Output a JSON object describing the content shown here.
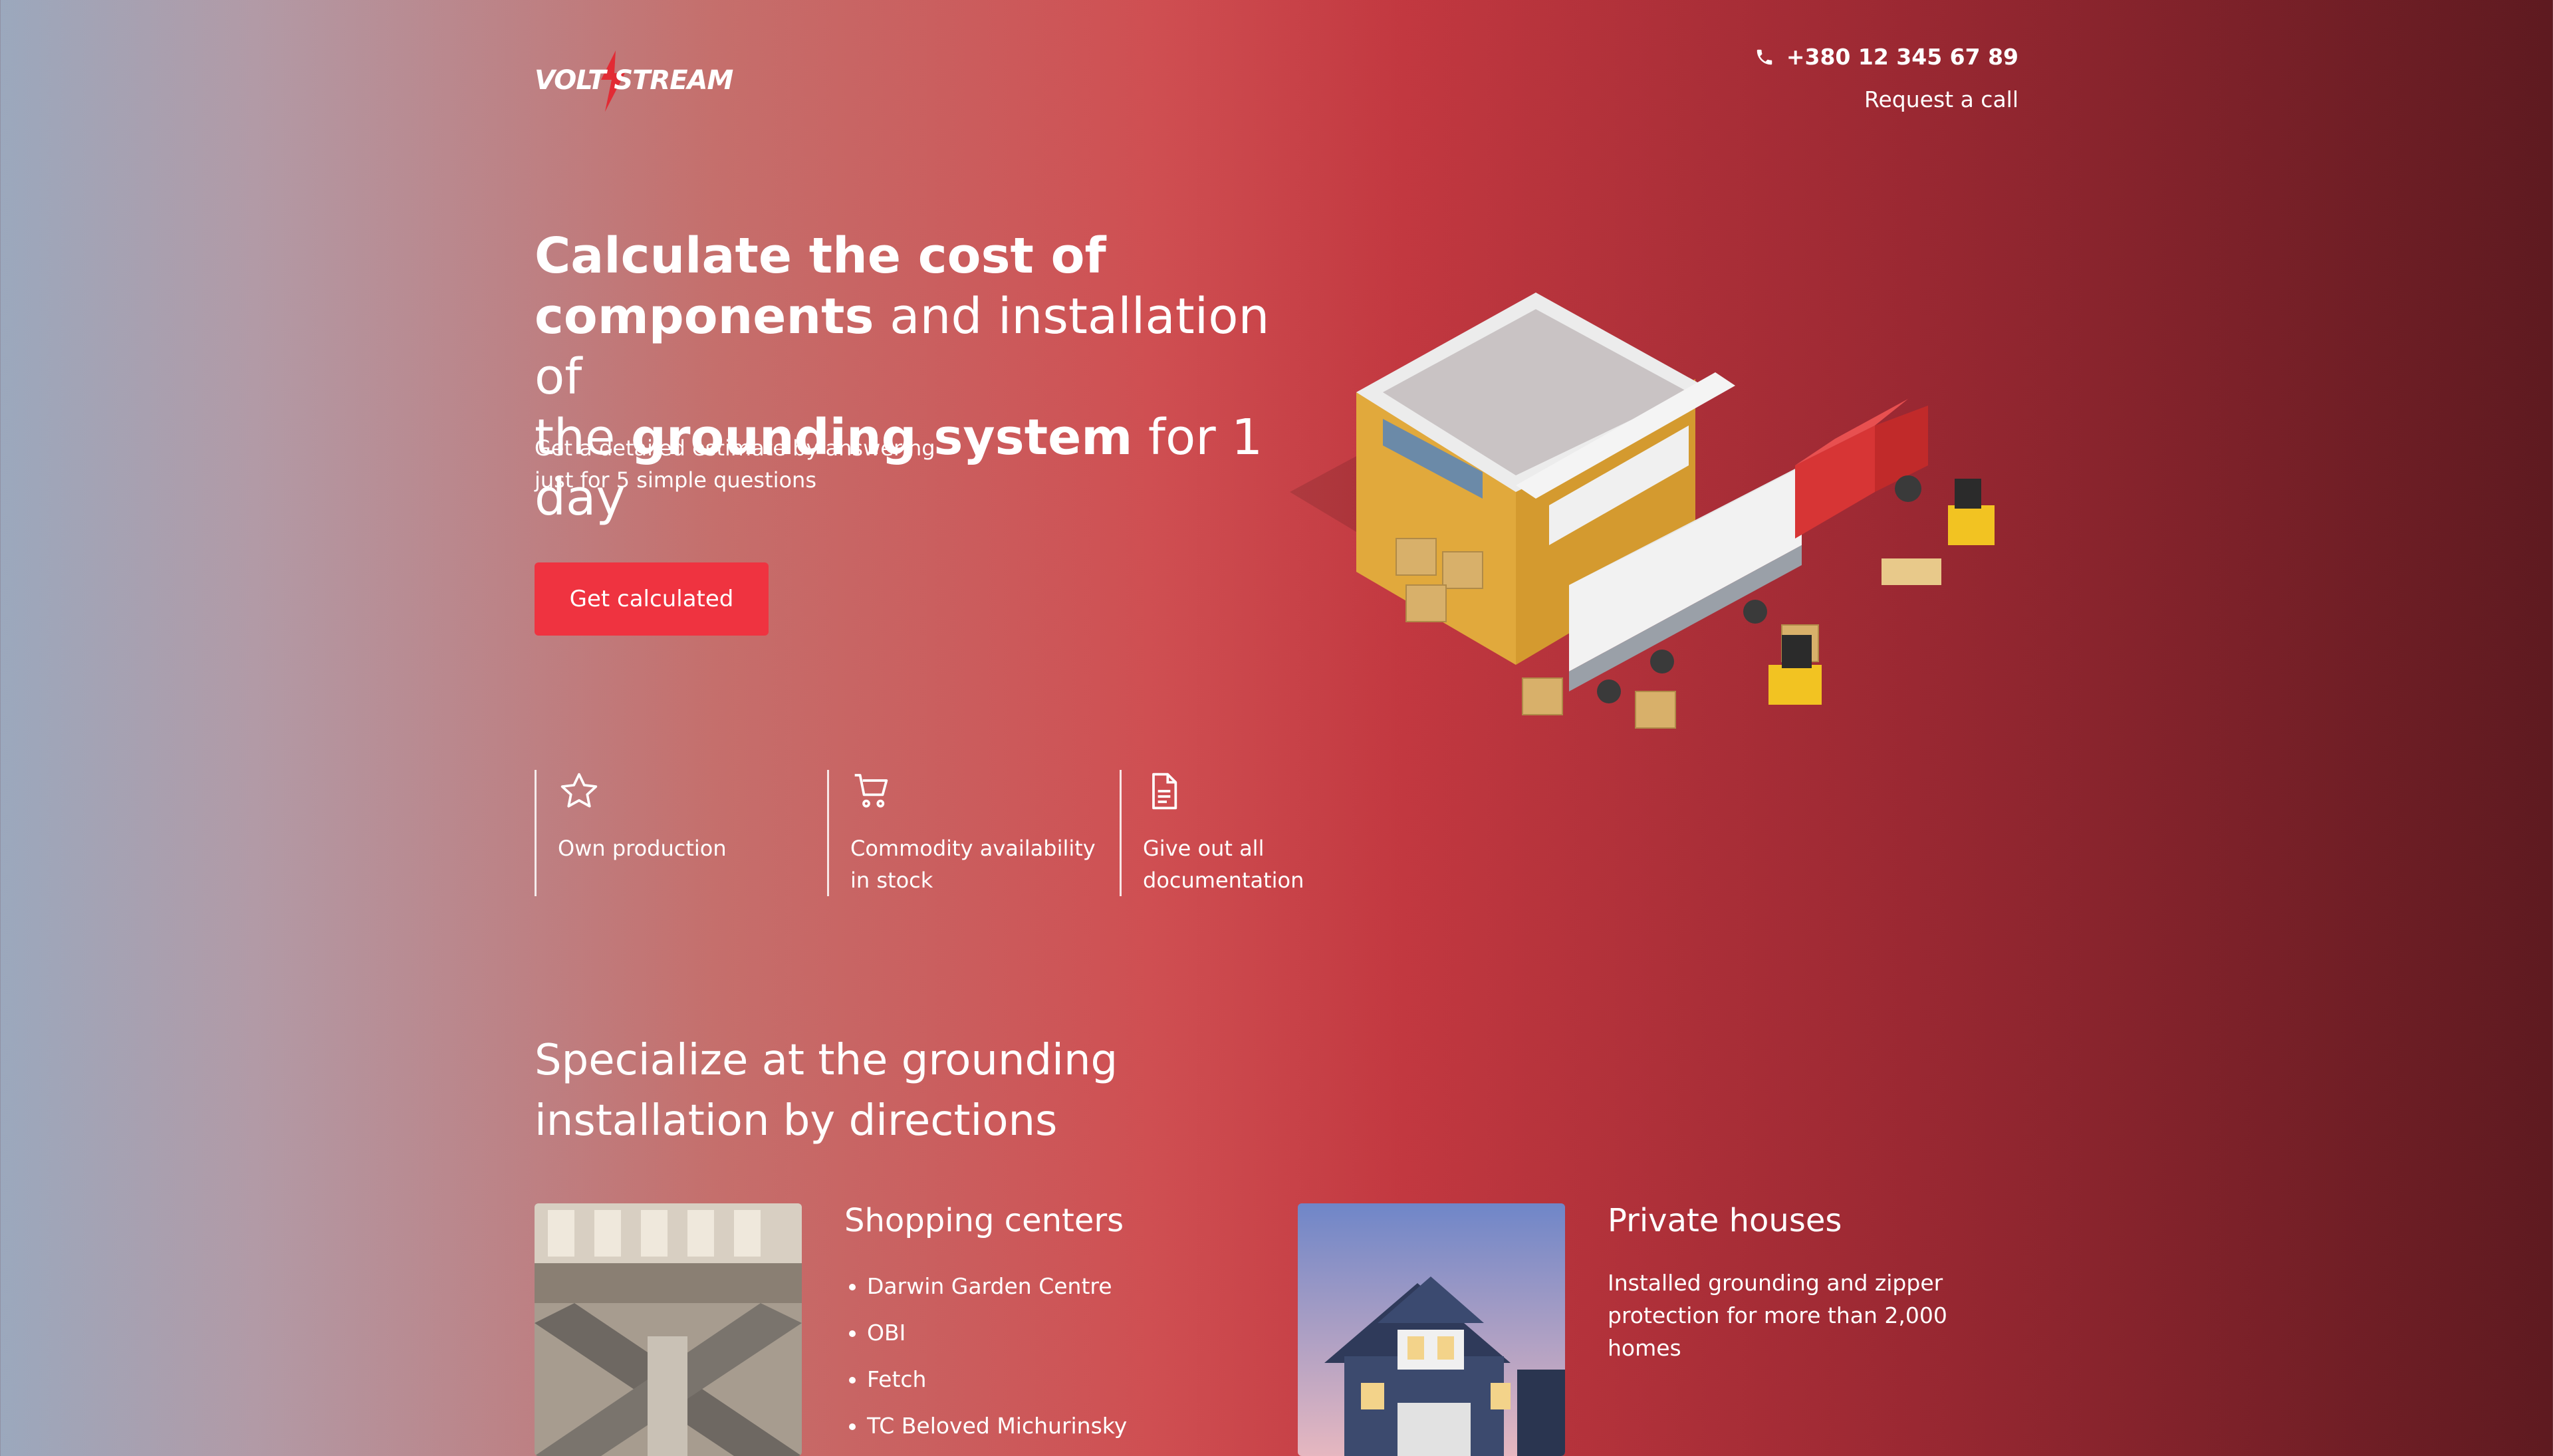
{
  "header": {
    "logo_text": "VOLT STREAM",
    "phone": "+380 12 345 67 89",
    "request_call": "Request a call"
  },
  "hero": {
    "title_parts": [
      "Calculate the cost of",
      "components",
      " and installation of",
      "the ",
      "grounding system",
      " for 1 day"
    ],
    "subtitle_line1": "Get a detailed estimate by answering",
    "subtitle_line2": "just for 5 simple questions",
    "cta_label": "Get calculated"
  },
  "features": [
    {
      "icon": "star-icon",
      "line1": "Own production",
      "line2": ""
    },
    {
      "icon": "cart-icon",
      "line1": "Commodity availability",
      "line2": "in stock"
    },
    {
      "icon": "document-icon",
      "line1": "Give out all",
      "line2": "documentation"
    }
  ],
  "section": {
    "title_line1": "Specialize at the grounding",
    "title_line2": "installation by directions",
    "cards": [
      {
        "title": "Shopping centers",
        "items": [
          "Darwin Garden Centre",
          "OBI",
          "Fetch",
          "TC Beloved Michurinsky"
        ]
      },
      {
        "title": "Private houses",
        "desc_line1": "Installed grounding and zipper",
        "desc_line2": "protection for more than 2,000 homes"
      }
    ]
  },
  "colors": {
    "accent": "#ef3340",
    "text": "#ffffff"
  }
}
